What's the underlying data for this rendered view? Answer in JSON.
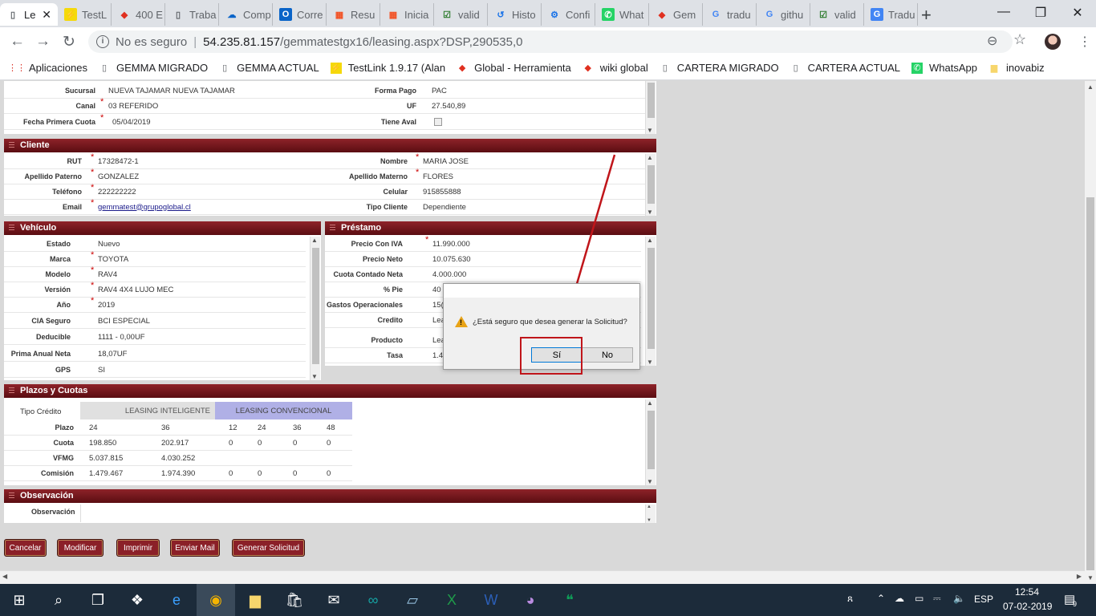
{
  "browser": {
    "tabs": [
      {
        "title": "Le",
        "icon": "page-icon",
        "active": true
      },
      {
        "title": "TestL",
        "icon": "testlink-icon"
      },
      {
        "title": "400 E",
        "icon": "global-icon"
      },
      {
        "title": "Traba",
        "icon": "page-icon"
      },
      {
        "title": "Comp",
        "icon": "onedrive-icon"
      },
      {
        "title": "Corre",
        "icon": "outlook-icon"
      },
      {
        "title": "Resu",
        "icon": "microsoft-icon"
      },
      {
        "title": "Inicia",
        "icon": "microsoft-icon"
      },
      {
        "title": "valid",
        "icon": "checkbox-icon"
      },
      {
        "title": "Histo",
        "icon": "history-icon"
      },
      {
        "title": "Confi",
        "icon": "gear-icon"
      },
      {
        "title": "What",
        "icon": "whatsapp-icon"
      },
      {
        "title": "Gem",
        "icon": "global-icon"
      },
      {
        "title": "tradu",
        "icon": "google-icon"
      },
      {
        "title": "githu",
        "icon": "google-icon"
      },
      {
        "title": "valid",
        "icon": "checkbox-icon"
      },
      {
        "title": "Tradu",
        "icon": "translate-icon"
      }
    ],
    "close_glyph": "✕",
    "new_tab": "+",
    "window": {
      "minimize": "—",
      "maximize": "❐",
      "close": "✕"
    },
    "nav": {
      "back": "←",
      "forward": "→",
      "reload": "↻"
    },
    "url": {
      "security": "No es seguro",
      "host": "54.235.81.157",
      "path": "/gemmatestgx16/leasing.aspx?DSP,290535,0"
    },
    "zoom_icon": "⊖",
    "star_icon": "☆",
    "bookmarks": [
      {
        "label": "Aplicaciones",
        "icon": "apps-icon"
      },
      {
        "label": "GEMMA MIGRADO",
        "icon": "page-icon"
      },
      {
        "label": "GEMMA ACTUAL",
        "icon": "page-icon"
      },
      {
        "label": "TestLink 1.9.17 (Alan",
        "icon": "testlink-icon"
      },
      {
        "label": "Global - Herramienta",
        "icon": "global-icon"
      },
      {
        "label": "wiki global",
        "icon": "global-icon"
      },
      {
        "label": "CARTERA MIGRADO",
        "icon": "page-icon"
      },
      {
        "label": "CARTERA ACTUAL",
        "icon": "page-icon"
      },
      {
        "label": "WhatsApp",
        "icon": "whatsapp-icon"
      },
      {
        "label": "inovabiz",
        "icon": "folder-icon"
      }
    ]
  },
  "form": {
    "top": {
      "sucursal_label": "Sucursal",
      "sucursal": "NUEVA TAJAMAR NUEVA TAJAMAR",
      "canal_label": "Canal",
      "canal": "03 REFERIDO",
      "fecha_label": "Fecha Primera Cuota",
      "fecha": "05/04/2019",
      "forma_label": "Forma Pago",
      "forma": "PAC",
      "uf_label": "UF",
      "uf": "27.540,89",
      "aval_label": "Tiene Aval"
    },
    "cliente": {
      "title": "Cliente",
      "rut_label": "RUT",
      "rut": "17328472-1",
      "ap_pat_label": "Apellido Paterno",
      "ap_pat": "GONZALEZ",
      "tel_label": "Teléfono",
      "tel": "222222222",
      "email_label": "Email",
      "email": "gemmatest@grupoglobal.cl",
      "nombre_label": "Nombre",
      "nombre": "MARIA JOSE",
      "ap_mat_label": "Apellido Materno",
      "ap_mat": "FLORES",
      "cel_label": "Celular",
      "cel": "915855888",
      "tipo_label": "Tipo Cliente",
      "tipo": "Dependiente"
    },
    "vehiculo": {
      "title": "Vehículo",
      "rows": [
        {
          "label": "Estado",
          "value": "Nuevo",
          "req": false
        },
        {
          "label": "Marca",
          "value": "TOYOTA",
          "req": true
        },
        {
          "label": "Modelo",
          "value": "RAV4",
          "req": true
        },
        {
          "label": "Versión",
          "value": "RAV4 4X4 LUJO MEC",
          "req": true
        },
        {
          "label": "Año",
          "value": "2019",
          "req": true
        },
        {
          "label": "CIA Seguro",
          "value": "BCI ESPECIAL",
          "req": false
        },
        {
          "label": "Deducible",
          "value": "1111  -  0,00UF",
          "req": false
        },
        {
          "label": "Prima Anual Neta",
          "value": "18,07UF",
          "req": false
        },
        {
          "label": "GPS",
          "value": "SI",
          "req": false
        }
      ]
    },
    "prestamo": {
      "title": "Préstamo",
      "rows": [
        {
          "label": "Precio Con IVA",
          "value": "11.990.000",
          "req": true
        },
        {
          "label": "Precio Neto",
          "value": "10.075.630",
          "req": false
        },
        {
          "label": "Cuota Contado Neta",
          "value": "4.000.000",
          "req": false
        },
        {
          "label": "% Pie",
          "value": "40",
          "req": false
        },
        {
          "label": "Gastos Operacionales",
          "value": "15(",
          "req": false
        },
        {
          "label": "Credito",
          "value": "Lea",
          "req": false
        },
        {
          "label": "Producto",
          "value": "Lea",
          "req": false
        },
        {
          "label": "Tasa",
          "value": "1.4",
          "req": false
        }
      ]
    },
    "plazos": {
      "title": "Plazos y Cuotas",
      "tipo_label": "Tipo Crédito",
      "inteligente": "LEASING INTELIGENTE",
      "convencional": "LEASING CONVENCIONAL",
      "row_labels": [
        "Plazo",
        "Cuota",
        "VFMG",
        "Comisión"
      ],
      "rows": [
        [
          "24",
          "36",
          "12",
          "24",
          "36",
          "48"
        ],
        [
          "198.850",
          "202.917",
          "0",
          "0",
          "0",
          "0"
        ],
        [
          "5.037.815",
          "4.030.252",
          "",
          "",
          "",
          ""
        ],
        [
          "1.479.467",
          "1.974.390",
          "0",
          "0",
          "0",
          "0"
        ]
      ]
    },
    "observacion": {
      "title": "Observación",
      "label": "Observación"
    },
    "buttons": [
      "Cancelar",
      "Modificar",
      "Imprimir",
      "Enviar Mail",
      "Generar Solicitud"
    ]
  },
  "dialog": {
    "message": "¿Está seguro que desea generar la Solicitud?",
    "yes": "Sí",
    "no": "No",
    "annotation_color": "#c0151a"
  },
  "taskbar": {
    "apps": [
      "windows-icon",
      "search-icon",
      "task-view-icon",
      "dropbox-icon",
      "edge-icon",
      "chrome-icon",
      "file-explorer-icon",
      "store-icon",
      "mail-icon",
      "arduino-icon",
      "notepad-icon",
      "excel-icon",
      "word-icon",
      "cat-icon",
      "hangouts-icon"
    ],
    "lang": "ESP",
    "time": "12:54",
    "date": "07-02-2019",
    "notifications": "9"
  }
}
